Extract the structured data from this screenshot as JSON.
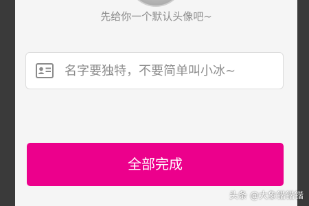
{
  "profile": {
    "avatar_caption": "先给你一个默认头像吧~"
  },
  "name_field": {
    "placeholder": "名字要独特，不要简单叫小冰~",
    "value": "",
    "icon": "id-card-icon"
  },
  "actions": {
    "complete_label": "全部完成"
  },
  "watermark": {
    "text": "头条 @大象锴锴锴"
  },
  "colors": {
    "accent": "#ec008c",
    "background": "#f5f5f5",
    "outer_background": "#3a3a3a",
    "caption_text": "#8a8a8a",
    "placeholder_text": "#8c8c8c"
  }
}
